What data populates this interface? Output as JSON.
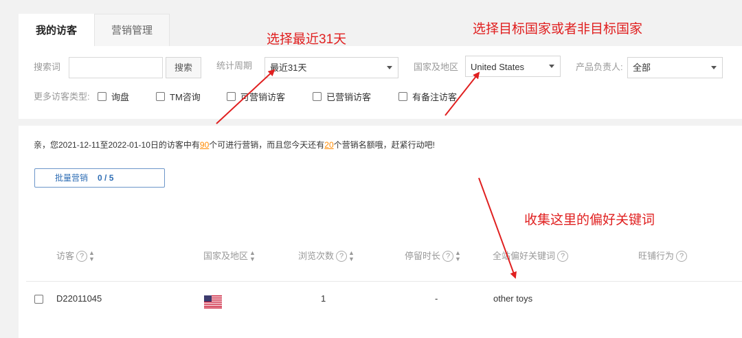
{
  "tabs": [
    "我的访客",
    "营销管理"
  ],
  "filters": {
    "search_label": "搜索词",
    "search_value": "",
    "search_button": "搜索",
    "period_label": "统计周期",
    "period_value": "最近31天",
    "country_label": "国家及地区",
    "country_value": "United States",
    "owner_label": "产品负责人:",
    "owner_value": "全部",
    "more_types_label": "更多访客类型:",
    "checkboxes": [
      "询盘",
      "TM咨询",
      "可营销访客",
      "已营销访客",
      "有备注访客"
    ]
  },
  "notice": {
    "prefix": "亲，您2021-12-11至2022-01-10日的访客中有",
    "count1": "90",
    "middle": "个可进行营销，而且您今天还有",
    "count2": "20",
    "suffix": "个营销名额哦，赶紧行动吧!"
  },
  "batch": {
    "label": "批量营销",
    "count": "0 / 5"
  },
  "table": {
    "headers": [
      "访客",
      "国家及地区",
      "浏览次数",
      "停留时长",
      "全站偏好关键词",
      "旺铺行为"
    ],
    "rows": [
      {
        "visitor": "D22011045",
        "country_flag": "us-flag-icon",
        "views": "1",
        "duration": "-",
        "keywords": "other toys"
      }
    ]
  },
  "annotations": {
    "period": "选择最近31天",
    "country": "选择目标国家或者非目标国家",
    "keywords": "收集这里的偏好关键词"
  },
  "colors": {
    "annotation": "#e02020",
    "highlight": "#ff8a00",
    "link": "#2e6db4"
  }
}
